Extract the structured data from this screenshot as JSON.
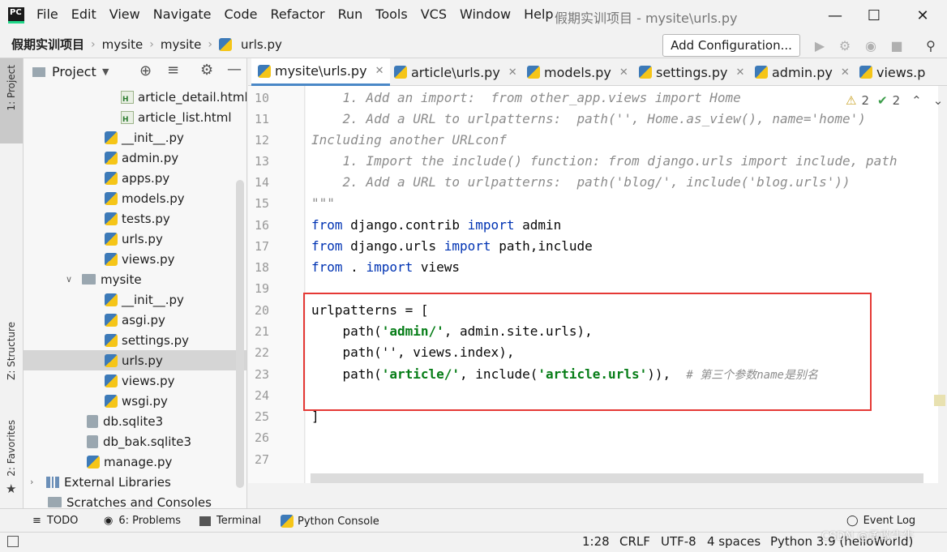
{
  "menubar": {
    "logo": "PC",
    "items": [
      "File",
      "Edit",
      "View",
      "Navigate",
      "Code",
      "Refactor",
      "Run",
      "Tools",
      "VCS",
      "Window",
      "Help"
    ],
    "title": "假期实训项目 - mysite\\urls.py"
  },
  "navbar": {
    "breadcrumb": [
      "假期实训项目",
      "mysite",
      "mysite",
      "urls.py"
    ],
    "add_config": "Add Configuration..."
  },
  "left_strip": {
    "project_tab": "1: Project",
    "structure_tab": "Z: Structure",
    "favorites_tab": "2: Favorites"
  },
  "project_panel": {
    "header": "Project",
    "items": [
      {
        "label": "article_detail.html",
        "icon": "html-icon"
      },
      {
        "label": "article_list.html",
        "icon": "html-icon"
      },
      {
        "label": "__init__.py",
        "icon": "python-file-icon"
      },
      {
        "label": "admin.py",
        "icon": "python-file-icon"
      },
      {
        "label": "apps.py",
        "icon": "python-file-icon"
      },
      {
        "label": "models.py",
        "icon": "python-file-icon"
      },
      {
        "label": "tests.py",
        "icon": "python-file-icon"
      },
      {
        "label": "urls.py",
        "icon": "python-file-icon"
      },
      {
        "label": "views.py",
        "icon": "python-file-icon"
      },
      {
        "label": "mysite",
        "icon": "folder-icon"
      },
      {
        "label": "__init__.py",
        "icon": "python-file-icon"
      },
      {
        "label": "asgi.py",
        "icon": "python-file-icon"
      },
      {
        "label": "settings.py",
        "icon": "python-file-icon"
      },
      {
        "label": "urls.py",
        "icon": "python-file-icon"
      },
      {
        "label": "views.py",
        "icon": "python-file-icon"
      },
      {
        "label": "wsgi.py",
        "icon": "python-file-icon"
      },
      {
        "label": "db.sqlite3",
        "icon": "database-icon"
      },
      {
        "label": "db_bak.sqlite3",
        "icon": "database-icon"
      },
      {
        "label": "manage.py",
        "icon": "python-file-icon"
      },
      {
        "label": "External Libraries",
        "icon": "library-icon"
      },
      {
        "label": "Scratches and Consoles",
        "icon": "scratches-icon"
      }
    ]
  },
  "editor_tabs": [
    "mysite\\urls.py",
    "article\\urls.py",
    "models.py",
    "settings.py",
    "admin.py",
    "views.p"
  ],
  "inspection": {
    "warnings": "2",
    "ok": "2"
  },
  "editor": {
    "line_numbers": [
      "10",
      "11",
      "12",
      "13",
      "14",
      "15",
      "16",
      "17",
      "18",
      "19",
      "20",
      "21",
      "22",
      "23",
      "24",
      "25",
      "26",
      "27"
    ],
    "lines": {
      "l10": "    1. Add an import:  from other_app.views import Home",
      "l11": "    2. Add a URL to urlpatterns:  path('', Home.as_view(), name='home')",
      "l12": "Including another URLconf",
      "l13": "    1. Import the include() function: from django.urls import include, path",
      "l14": "    2. Add a URL to urlpatterns:  path('blog/', include('blog.urls'))",
      "l15": "\"\"\"",
      "l16_kw1": "from",
      "l16_a": " django.contrib ",
      "l16_kw2": "import",
      "l16_b": " admin",
      "l17_kw1": "from",
      "l17_a": " django.urls ",
      "l17_kw2": "import",
      "l17_b": " path,include",
      "l18_kw1": "from",
      "l18_a": " . ",
      "l18_kw2": "import",
      "l18_b": " views",
      "l20": "urlpatterns = [",
      "l21_a": "    path(",
      "l21_s": "'admin/'",
      "l21_b": ", admin.site.urls),",
      "l22": "    path('', views.index),",
      "l23_a": "    path(",
      "l23_s1": "'article/'",
      "l23_b": ", include(",
      "l23_s2": "'article.urls'",
      "l23_c": ")),  ",
      "l23_comment": "# 第三个参数name是别名",
      "l25": "]"
    }
  },
  "bottom_tools": [
    "TODO",
    "6: Problems",
    "Terminal",
    "Python Console",
    "Event Log"
  ],
  "statusbar": {
    "position": "1:28",
    "line_sep": "CRLF",
    "encoding": "UTF-8",
    "indent": "4 spaces",
    "interpreter": "Python 3.9 (helloWorld)",
    "watermark": "CSDN @勇敢牛牛"
  }
}
